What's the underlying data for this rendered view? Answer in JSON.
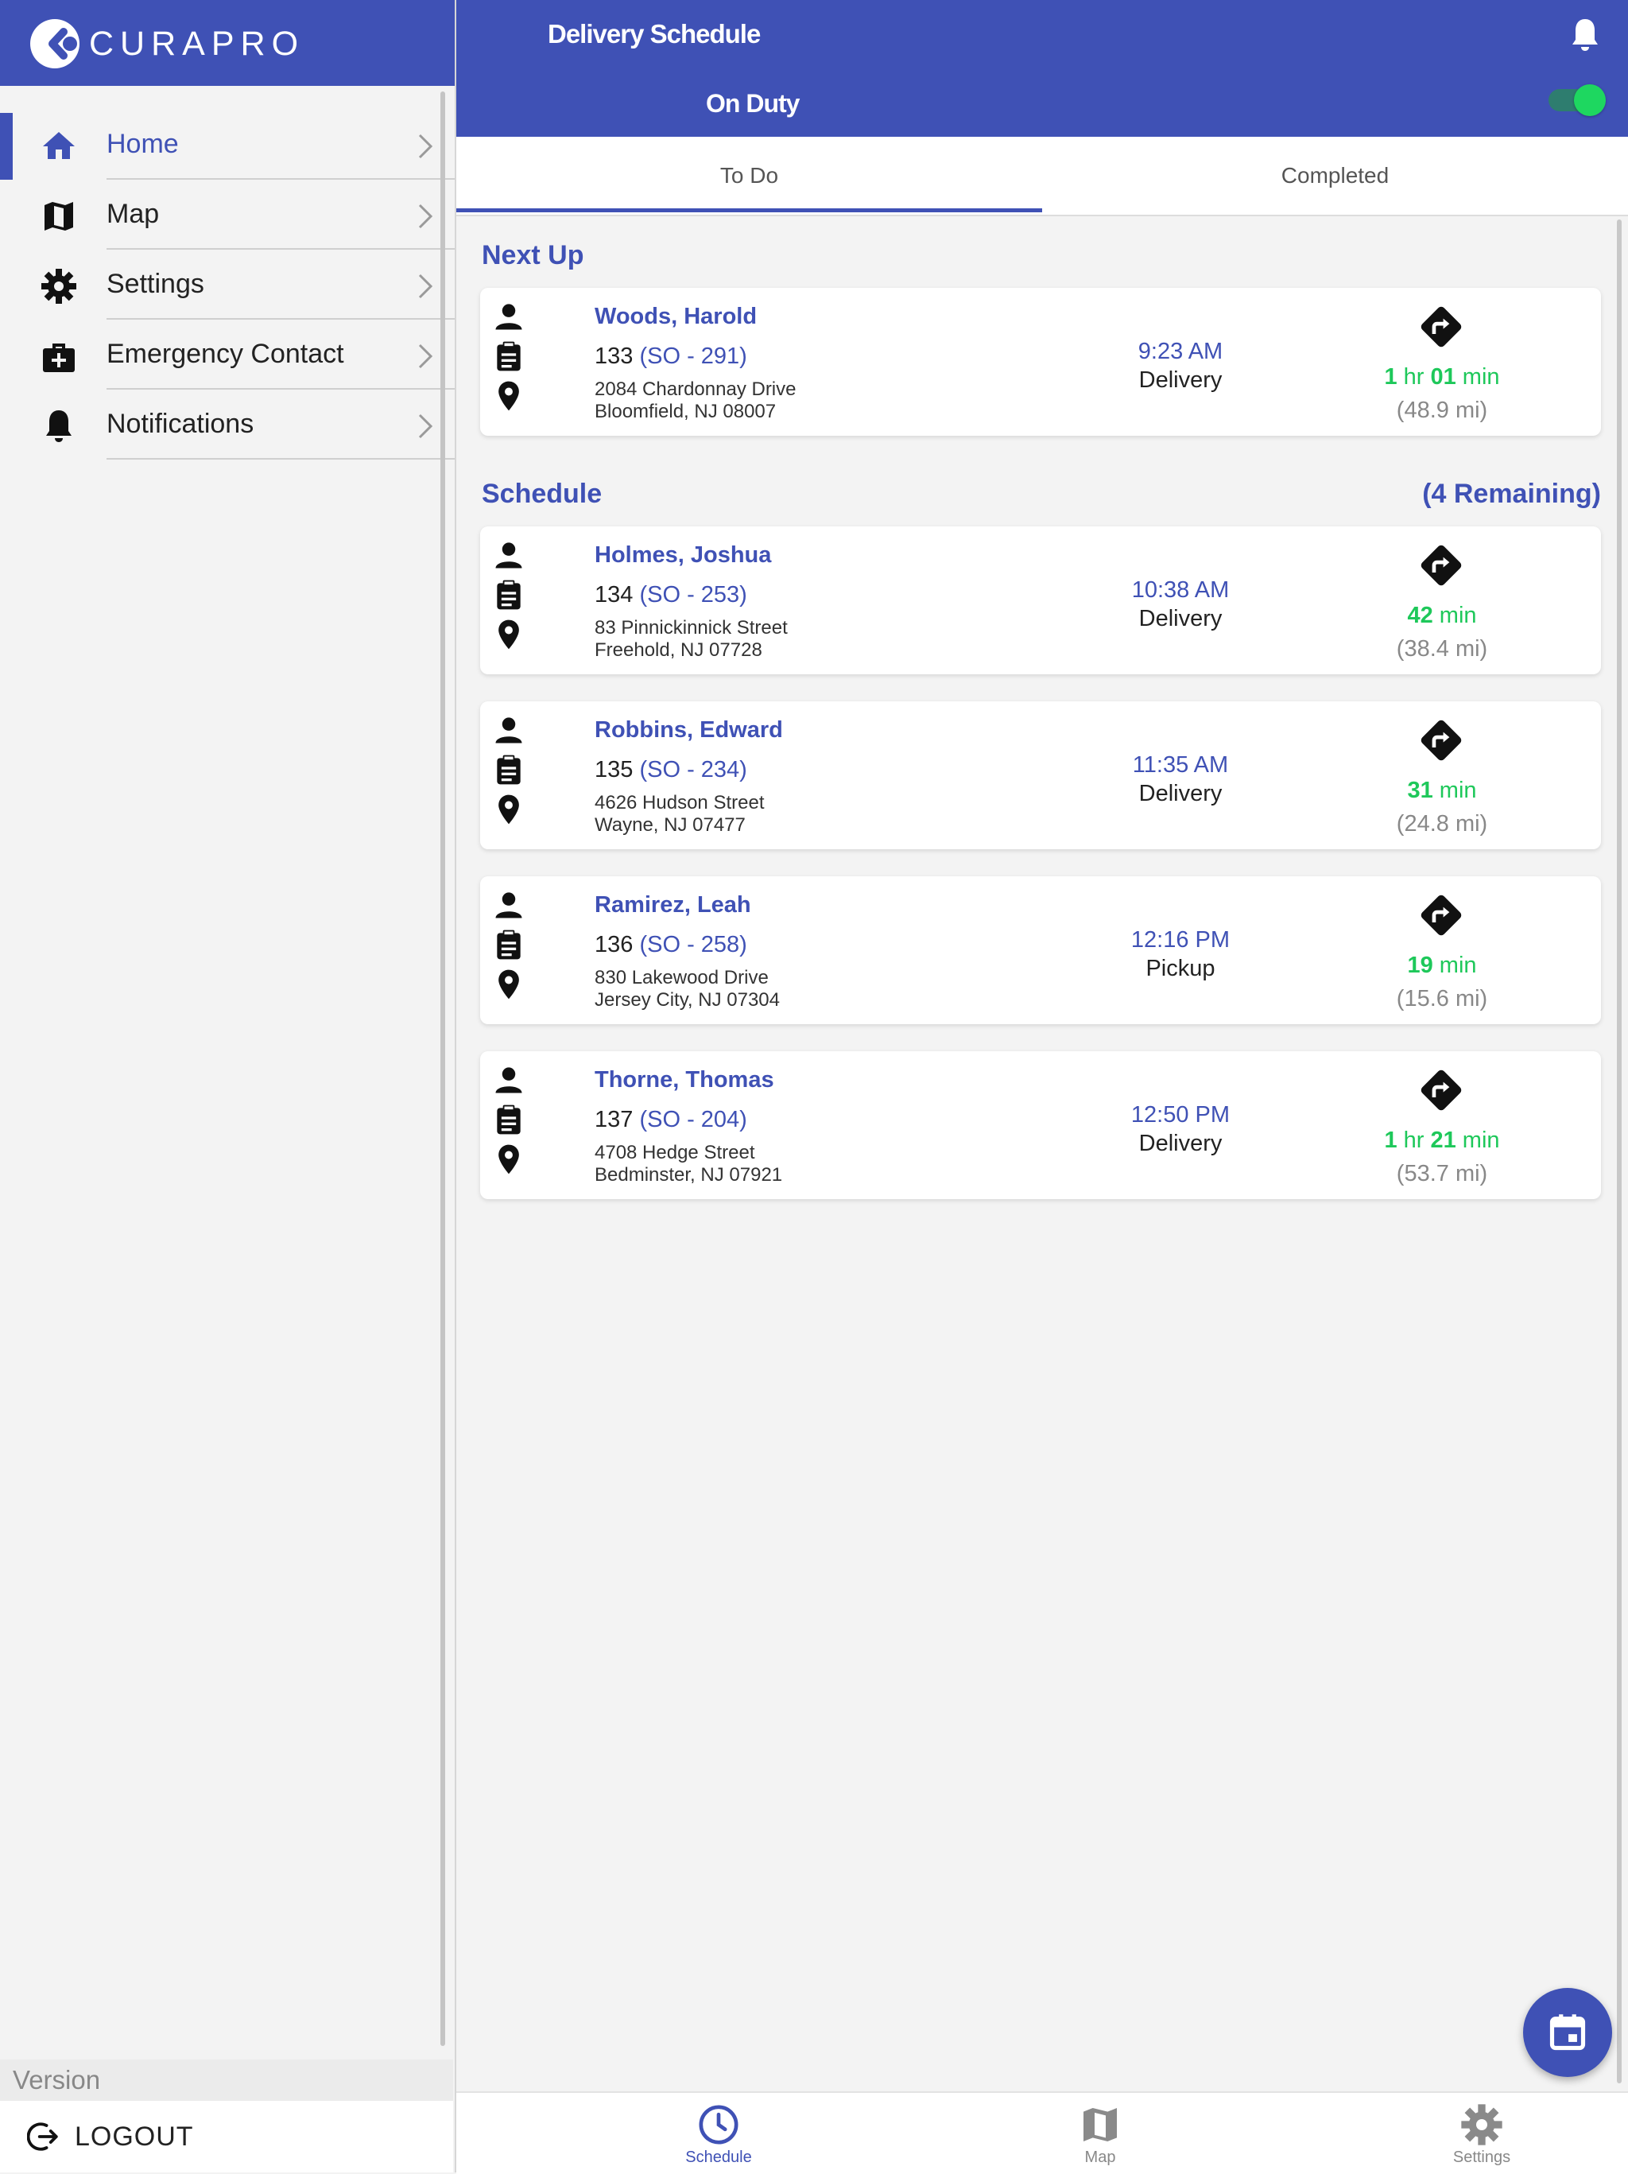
{
  "brand": {
    "name": "CURAPRO",
    "color": "#3f51b5"
  },
  "sidebar": {
    "items": [
      {
        "label": "Home",
        "icon": "home-icon",
        "active": true
      },
      {
        "label": "Map",
        "icon": "map-icon"
      },
      {
        "label": "Settings",
        "icon": "gear-icon"
      },
      {
        "label": "Emergency Contact",
        "icon": "medical-kit-icon"
      },
      {
        "label": "Notifications",
        "icon": "bell-icon"
      }
    ],
    "version_label": "Version",
    "logout_label": "LOGOUT"
  },
  "header": {
    "title": "Delivery Schedule",
    "duty_label": "On Duty",
    "on_duty": true
  },
  "tabs": [
    {
      "label": "To Do",
      "active": true
    },
    {
      "label": "Completed",
      "active": false
    }
  ],
  "next_up": {
    "title": "Next Up",
    "card": {
      "name": "Woods, Harold",
      "order_no": "133",
      "so": "(SO - 291)",
      "address_line1": "2084 Chardonnay Drive",
      "address_line2": "Bloomfield, NJ 08007",
      "time": "9:23 AM",
      "type": "Delivery",
      "eta_parts": [
        "1",
        " hr ",
        "01",
        " min"
      ],
      "distance": "(48.9 mi)"
    }
  },
  "schedule": {
    "title": "Schedule",
    "remaining": "(4 Remaining)",
    "cards": [
      {
        "name": "Holmes, Joshua",
        "order_no": "134",
        "so": "(SO - 253)",
        "address_line1": "83 Pinnickinnick Street",
        "address_line2": "Freehold, NJ 07728",
        "time": "10:38 AM",
        "type": "Delivery",
        "eta_parts": [
          "42",
          " min"
        ],
        "distance": "(38.4 mi)"
      },
      {
        "name": "Robbins, Edward",
        "order_no": "135",
        "so": "(SO - 234)",
        "address_line1": "4626 Hudson Street",
        "address_line2": "Wayne, NJ 07477",
        "time": "11:35 AM",
        "type": "Delivery",
        "eta_parts": [
          "31",
          " min"
        ],
        "distance": "(24.8 mi)"
      },
      {
        "name": "Ramirez, Leah",
        "order_no": "136",
        "so": "(SO - 258)",
        "address_line1": "830 Lakewood Drive",
        "address_line2": "Jersey City, NJ 07304",
        "time": "12:16 PM",
        "type": "Pickup",
        "eta_parts": [
          "19",
          " min"
        ],
        "distance": "(15.6 mi)"
      },
      {
        "name": "Thorne, Thomas",
        "order_no": "137",
        "so": "(SO - 204)",
        "address_line1": "4708 Hedge Street",
        "address_line2": "Bedminster, NJ 07921",
        "time": "12:50 PM",
        "type": "Delivery",
        "eta_parts": [
          "1",
          " hr ",
          "21",
          " min"
        ],
        "distance": "(53.7 mi)"
      }
    ]
  },
  "bottom_nav": [
    {
      "label": "Schedule",
      "icon": "clock-icon",
      "active": true
    },
    {
      "label": "Map",
      "icon": "map-icon",
      "active": false
    },
    {
      "label": "Settings",
      "icon": "gear-icon",
      "active": false
    }
  ],
  "colors": {
    "accent": "#3f51b5",
    "eta_green": "#1ec85a",
    "toggle_knob": "#1ed760"
  }
}
